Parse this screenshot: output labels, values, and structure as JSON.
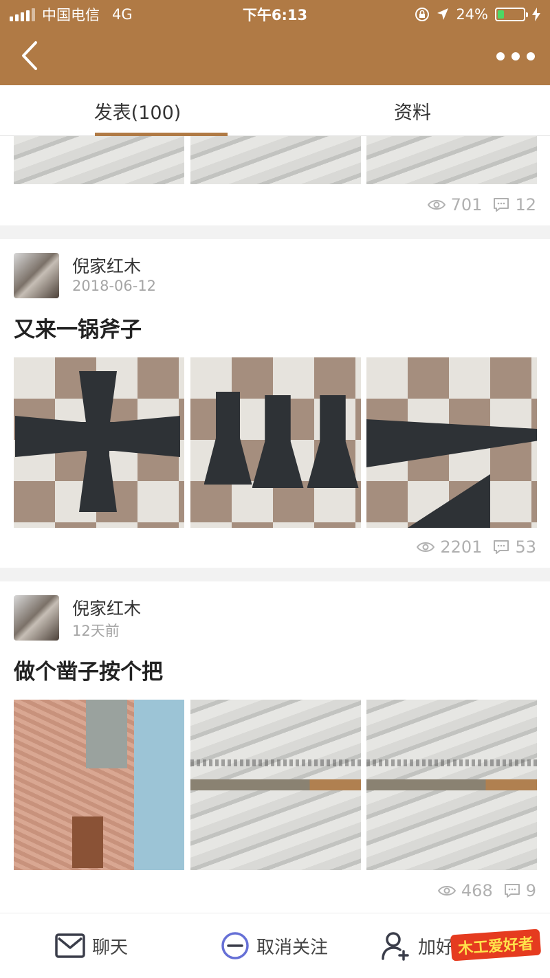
{
  "status_bar": {
    "carrier": "中国电信",
    "network": "4G",
    "time": "下午6:13",
    "battery": "24%",
    "battery_level": 0.24
  },
  "tabs": [
    {
      "label": "发表(100)",
      "active": true
    },
    {
      "label": "资料",
      "active": false
    }
  ],
  "posts": [
    {
      "views": "701",
      "comments": "12"
    },
    {
      "author": "倪家红木",
      "date": "2018-06-12",
      "title": "又来一锅斧子",
      "views": "2201",
      "comments": "53"
    },
    {
      "author": "倪家红木",
      "date": "12天前",
      "title": "做个凿子按个把",
      "views": "468",
      "comments": "9"
    }
  ],
  "bottom_bar": {
    "chat": "聊天",
    "unfollow": "取消关注",
    "add_friend": "加好"
  },
  "watermark": "木工爱好者",
  "colors": {
    "brand": "#b07a45",
    "stat_gray": "#b0b0b0",
    "unfollow_icon": "#6670d6"
  }
}
